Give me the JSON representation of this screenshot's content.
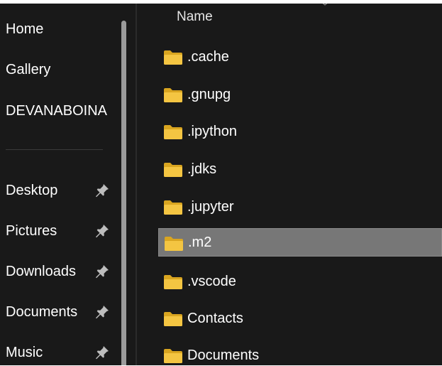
{
  "nav": {
    "items": [
      {
        "label": "Home",
        "pinned": false
      },
      {
        "label": "Gallery",
        "pinned": false
      },
      {
        "label": "DEVANABOINA",
        "pinned": false
      },
      {
        "label": "Desktop",
        "pinned": true
      },
      {
        "label": "Pictures",
        "pinned": true
      },
      {
        "label": "Downloads",
        "pinned": true
      },
      {
        "label": "Documents",
        "pinned": true
      },
      {
        "label": "Music",
        "pinned": true
      }
    ]
  },
  "content": {
    "column_header": "Name",
    "rows": [
      {
        "name": ".cache",
        "selected": false
      },
      {
        "name": ".gnupg",
        "selected": false
      },
      {
        "name": ".ipython",
        "selected": false
      },
      {
        "name": ".jdks",
        "selected": false
      },
      {
        "name": ".jupyter",
        "selected": false
      },
      {
        "name": ".m2",
        "selected": true
      },
      {
        "name": ".vscode",
        "selected": false
      },
      {
        "name": "Contacts",
        "selected": false
      },
      {
        "name": "Documents",
        "selected": false
      }
    ]
  },
  "icons": {
    "folder": "folder-icon",
    "pin": "pin-icon"
  },
  "colors": {
    "background": "#191919",
    "selection": "#777777",
    "folder": "#f4c542",
    "text": "#ffffff"
  }
}
